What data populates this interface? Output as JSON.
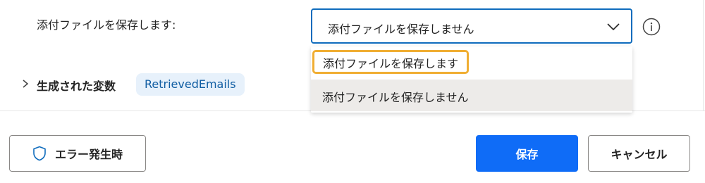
{
  "form": {
    "attachments_label": "添付ファイルを保存します:",
    "selected_value": "添付ファイルを保存しません",
    "options": [
      {
        "label": "添付ファイルを保存します"
      },
      {
        "label": "添付ファイルを保存しません"
      }
    ]
  },
  "variables": {
    "label": "生成された変数",
    "chip": "RetrievedEmails"
  },
  "footer": {
    "error_button": "エラー発生時",
    "save_button": "保存",
    "cancel_button": "キャンセル"
  },
  "colors": {
    "accent": "#0f6cf7",
    "focus_border": "#0f6cbd",
    "highlight_outline": "#f0ae33",
    "chip_background": "#e7f1fb",
    "chip_text": "#115ea3",
    "hover_option": "#edebe9"
  },
  "icons": [
    "chevron-down-icon",
    "info-icon",
    "chevron-right-icon",
    "shield-icon"
  ]
}
